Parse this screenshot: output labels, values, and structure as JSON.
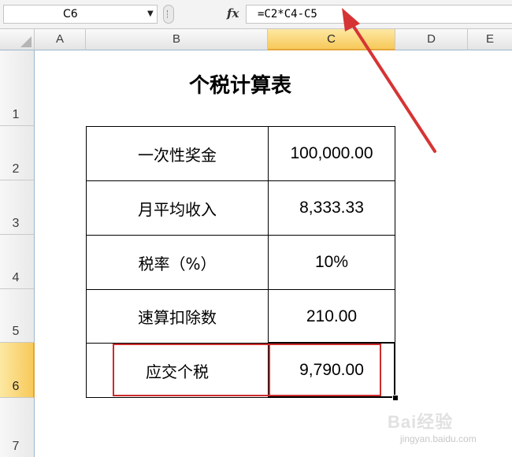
{
  "formula_bar": {
    "name_box": "C6",
    "fx_label": "fx",
    "formula": "=C2*C4-C5"
  },
  "columns": [
    "A",
    "B",
    "C",
    "D",
    "E"
  ],
  "selected_column": "C",
  "rows": [
    "1",
    "2",
    "3",
    "4",
    "5",
    "6",
    "7"
  ],
  "selected_row": "6",
  "sheet": {
    "title": "个税计算表",
    "table": [
      {
        "label": "一次性奖金",
        "value": "100,000.00"
      },
      {
        "label": "月平均收入",
        "value": "8,333.33"
      },
      {
        "label": "税率（%）",
        "value": "10%"
      },
      {
        "label": "速算扣除数",
        "value": "210.00"
      },
      {
        "label": "应交个税",
        "value": "9,790.00"
      }
    ]
  },
  "watermark": {
    "logo": "Bai经验",
    "url": "jingyan.baidu.com"
  },
  "colors": {
    "highlight": "#cc2b2b",
    "selected_header": "#f7c95a"
  }
}
